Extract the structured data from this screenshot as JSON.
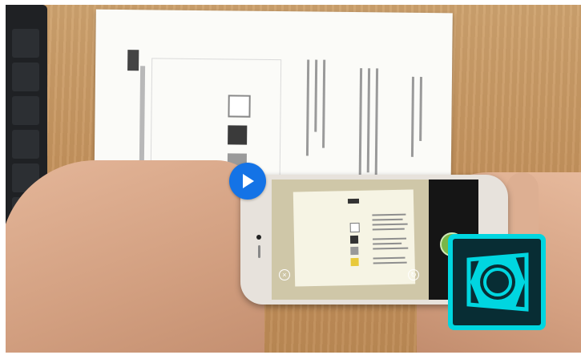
{
  "player": {
    "play_button": {
      "icon": "play-icon",
      "color": "#1473e6"
    }
  },
  "scene": {
    "description_hidden": "",
    "brand_logo": {
      "icon": "adobe-scan-logo",
      "border_color": "#00d6e0",
      "fill_color": "#082d34"
    },
    "phone_app": {
      "shutter_color": "#7ab648",
      "close_icon": "close-icon",
      "flip_icon": "flip-icon"
    }
  }
}
